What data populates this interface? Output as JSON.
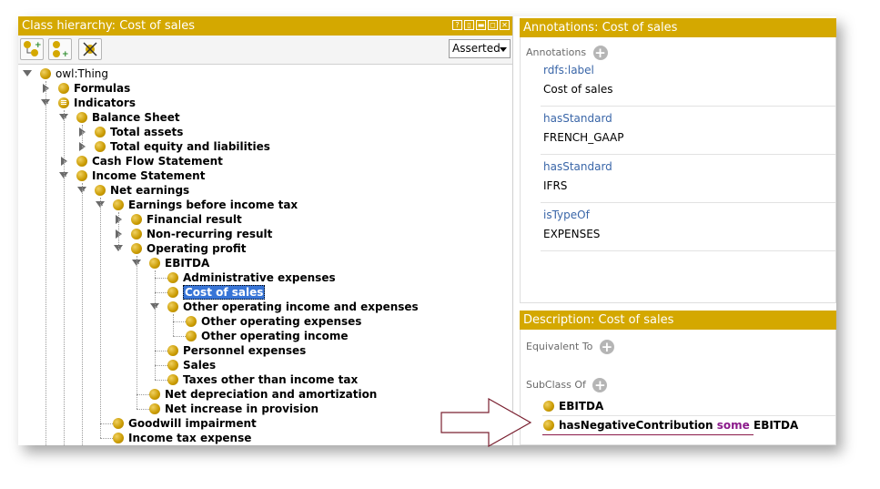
{
  "left_panel": {
    "title": "Class hierarchy: Cost of sales",
    "window_buttons": [
      "?",
      "▯",
      "▬",
      "◻",
      "✕"
    ],
    "toolbar": {
      "buttons": [
        "add-subclass-icon",
        "add-sibling-icon",
        "delete-class-icon"
      ],
      "view_select": "Asserted"
    },
    "tree": [
      {
        "label": "owl:Thing",
        "depth": 0,
        "toggle": "down",
        "root": true
      },
      {
        "label": "Formulas",
        "depth": 1,
        "toggle": "right"
      },
      {
        "label": "Indicators",
        "depth": 1,
        "toggle": "down",
        "icon": "equivalent-class-icon"
      },
      {
        "label": "Balance Sheet",
        "depth": 2,
        "toggle": "down"
      },
      {
        "label": "Total assets",
        "depth": 3,
        "toggle": "right"
      },
      {
        "label": "Total equity and liabilities",
        "depth": 3,
        "toggle": "right"
      },
      {
        "label": "Cash Flow Statement",
        "depth": 2,
        "toggle": "right"
      },
      {
        "label": "Income Statement",
        "depth": 2,
        "toggle": "down"
      },
      {
        "label": "Net earnings",
        "depth": 3,
        "toggle": "down"
      },
      {
        "label": "Earnings before income tax",
        "depth": 4,
        "toggle": "down"
      },
      {
        "label": "Financial result",
        "depth": 5,
        "toggle": "right"
      },
      {
        "label": "Non-recurring result",
        "depth": 5,
        "toggle": "right"
      },
      {
        "label": "Operating profit",
        "depth": 5,
        "toggle": "down"
      },
      {
        "label": "EBITDA",
        "depth": 6,
        "toggle": "down"
      },
      {
        "label": "Administrative expenses",
        "depth": 7
      },
      {
        "label": "Cost of sales",
        "depth": 7,
        "selected": true
      },
      {
        "label": "Other operating income and expenses",
        "depth": 7,
        "toggle": "down"
      },
      {
        "label": "Other operating expenses",
        "depth": 8
      },
      {
        "label": "Other operating income",
        "depth": 8
      },
      {
        "label": "Personnel expenses",
        "depth": 7
      },
      {
        "label": "Sales",
        "depth": 7
      },
      {
        "label": "Taxes other than income tax",
        "depth": 7
      },
      {
        "label": "Net depreciation and amortization",
        "depth": 6
      },
      {
        "label": "Net increase in provision",
        "depth": 6
      },
      {
        "label": "Goodwill impairment",
        "depth": 4
      },
      {
        "label": "Income tax expense",
        "depth": 4
      }
    ]
  },
  "annotations_panel": {
    "title": "Annotations: Cost of sales",
    "header": "Annotations",
    "items": [
      {
        "property": "rdfs:label",
        "value": "Cost of sales"
      },
      {
        "property": "hasStandard",
        "value": "FRENCH_GAAP"
      },
      {
        "property": "hasStandard",
        "value": "IFRS"
      },
      {
        "property": "isTypeOf",
        "value": "EXPENSES"
      }
    ]
  },
  "description_panel": {
    "title": "Description: Cost of sales",
    "equivalent_to": "Equivalent To",
    "subclass_of": "SubClass Of",
    "superclasses": [
      {
        "parts": [
          {
            "text": "EBITDA",
            "kw": false
          }
        ]
      },
      {
        "parts": [
          {
            "text": "hasNegativeContribution ",
            "kw": false
          },
          {
            "text": "some",
            "kw": true
          },
          {
            "text": " EBITDA",
            "kw": false
          }
        ]
      }
    ]
  },
  "colors": {
    "titlebar": "#d4a800",
    "selection": "#3875d7",
    "property": "#3a66a8",
    "keyword": "#8b1a8b",
    "arrow": "#7a2030"
  }
}
